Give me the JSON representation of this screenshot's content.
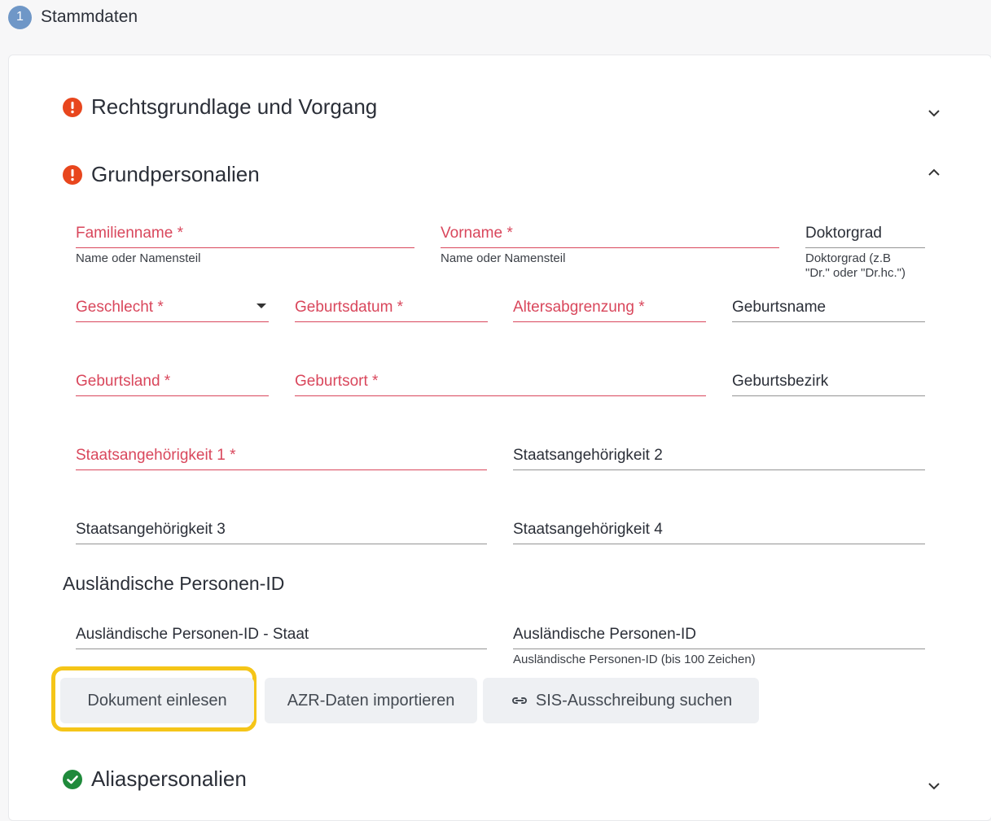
{
  "step": {
    "number": "1",
    "label": "Stammdaten"
  },
  "sections": {
    "rechtsgrundlage": {
      "title": "Rechtsgrundlage und Vorgang",
      "status": "error"
    },
    "grundpersonalien": {
      "title": "Grundpersonalien",
      "status": "error"
    },
    "aliaspersonalien": {
      "title": "Aliaspersonalien",
      "status": "ok"
    }
  },
  "fields": {
    "familienname": {
      "label": "Familienname *",
      "hint": "Name oder Namensteil"
    },
    "vorname": {
      "label": "Vorname *",
      "hint": "Name oder Namensteil"
    },
    "doktorgrad": {
      "label": "Doktorgrad",
      "hint_line1": "Doktorgrad (z.B",
      "hint_line2": "\"Dr.\" oder \"Dr.hc.\")"
    },
    "geschlecht": {
      "label": "Geschlecht *"
    },
    "geburtsdatum": {
      "label": "Geburtsdatum *"
    },
    "altersabgrenzung": {
      "label": "Altersabgrenzung *"
    },
    "geburtsname": {
      "label": "Geburtsname"
    },
    "geburtsland": {
      "label": "Geburtsland *"
    },
    "geburtsort": {
      "label": "Geburtsort *"
    },
    "geburtsbezirk": {
      "label": "Geburtsbezirk"
    },
    "staat1": {
      "label": "Staatsangehörigkeit 1 *"
    },
    "staat2": {
      "label": "Staatsangehörigkeit 2"
    },
    "staat3": {
      "label": "Staatsangehörigkeit 3"
    },
    "staat4": {
      "label": "Staatsangehörigkeit 4"
    },
    "auslid_staat": {
      "label": "Ausländische Personen-ID - Staat"
    },
    "auslid": {
      "label": "Ausländische Personen-ID",
      "hint": "Ausländische Personen-ID (bis 100 Zeichen)"
    }
  },
  "subheading": "Ausländische Personen-ID",
  "buttons": {
    "dokument": "Dokument einlesen",
    "azr": "AZR-Daten importieren",
    "sis": "SIS-Ausschreibung suchen"
  },
  "colors": {
    "required": "#d9475c",
    "error_icon": "#e8461d",
    "ok_icon": "#1f8a3b",
    "highlight": "#f5c518",
    "step_badge": "#6f97c7"
  },
  "icons": {
    "error": "exclamation-circle-icon",
    "ok": "check-circle-icon",
    "expand": "chevron-down-icon",
    "collapse": "chevron-up-icon",
    "link": "link-icon"
  }
}
